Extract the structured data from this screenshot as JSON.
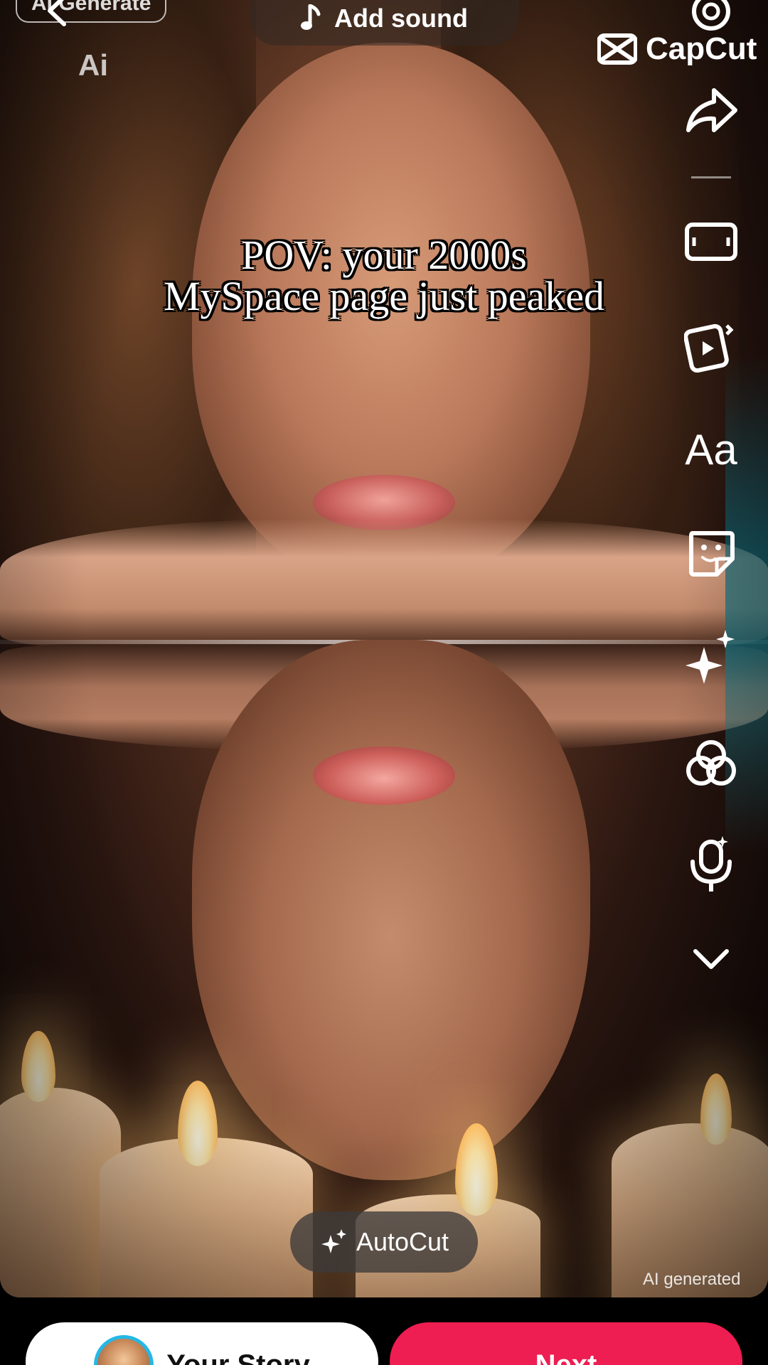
{
  "header": {
    "ai_generate_label": "AI Generate",
    "ai_badge": "Ai",
    "add_sound_label": "Add sound",
    "capcut_label": "CapCut"
  },
  "caption": {
    "line1": "POV: your 2000s",
    "line2": "MySpace page just peaked"
  },
  "rail": {
    "icons": [
      "settings-icon",
      "share-arrow-icon",
      "aspect-ratio-icon",
      "templates-icon",
      "text-icon",
      "sticker-icon",
      "effects-sparkle-icon",
      "filters-icon",
      "voice-effect-icon",
      "more-chevron-icon"
    ],
    "text_tool_label": "Aa"
  },
  "autocut": {
    "label": "AutoCut"
  },
  "watermark": {
    "ai_generated": "AI generated"
  },
  "bottom": {
    "story_label": "Your Story",
    "next_label": "Next"
  },
  "colors": {
    "next_button": "#ee1d52",
    "story_ring": "#24b8e6"
  }
}
